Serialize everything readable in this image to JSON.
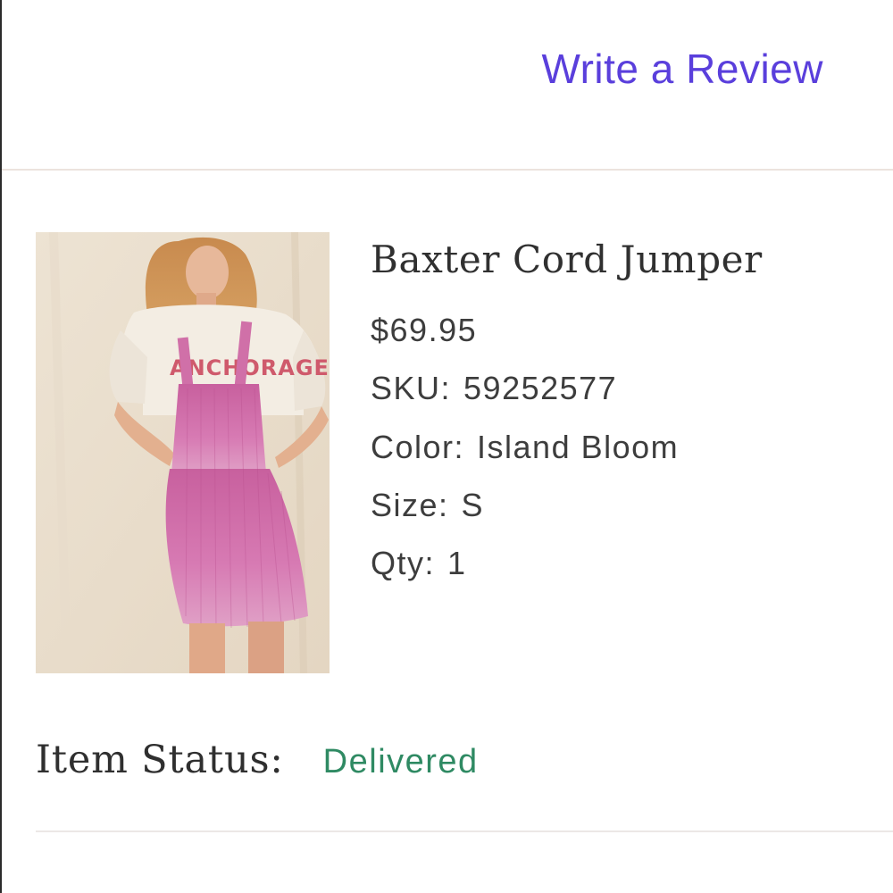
{
  "colors": {
    "accent": "#5a3fdc",
    "status_delivered": "#2f8a63"
  },
  "header": {
    "review_link_label": "Write a Review"
  },
  "product": {
    "image_icon": "product-photo",
    "image_alt": "Baxter Cord Jumper",
    "image_shirt_text": "ANCHORAGE",
    "name": "Baxter Cord Jumper",
    "price": "$69.95",
    "sku_label": "SKU:",
    "sku_value": "59252577",
    "color_label": "Color:",
    "color_value": "Island Bloom",
    "size_label": "Size:",
    "size_value": "S",
    "qty_label": "Qty:",
    "qty_value": "1"
  },
  "status": {
    "label": "Item Status:",
    "value": "Delivered"
  }
}
